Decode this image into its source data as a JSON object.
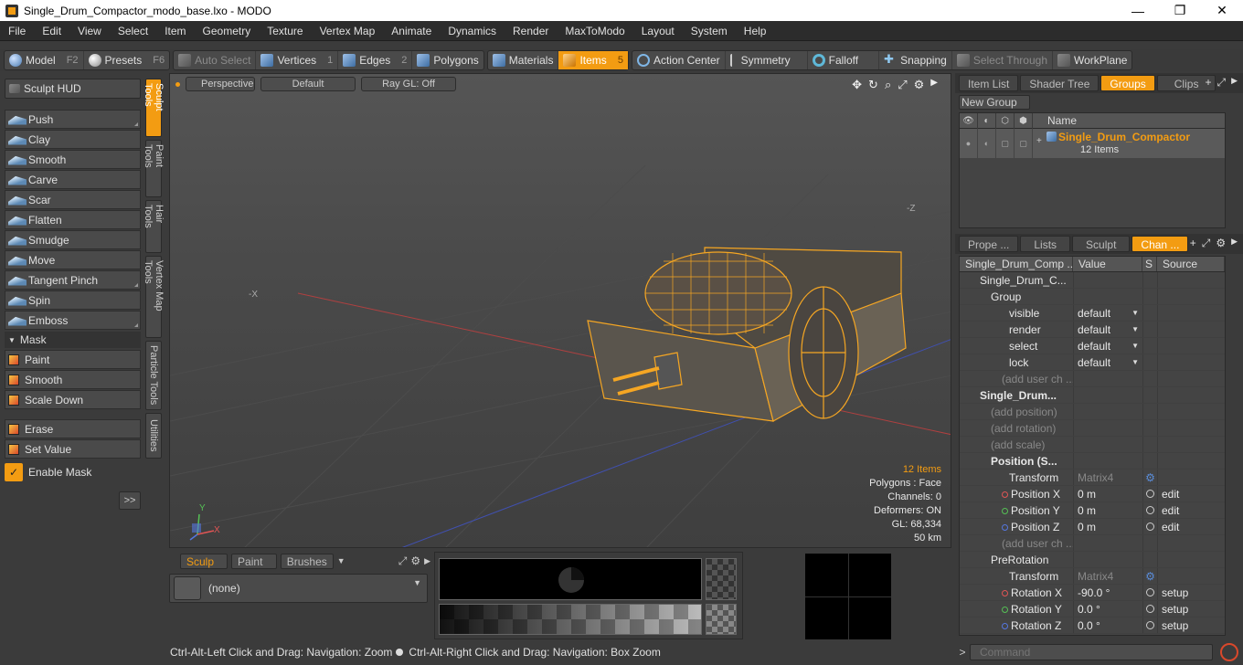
{
  "window": {
    "title": "Single_Drum_Compactor_modo_base.lxo - MODO",
    "minimize": "—",
    "maximize": "❐",
    "close": "✕"
  },
  "menu": [
    "File",
    "Edit",
    "View",
    "Select",
    "Item",
    "Geometry",
    "Texture",
    "Vertex Map",
    "Animate",
    "Dynamics",
    "Render",
    "MaxToModo",
    "Layout",
    "System",
    "Help"
  ],
  "toolbar": {
    "model": "Model",
    "model_key": "F2",
    "presets": "Presets",
    "presets_key": "F6",
    "auto_select": "Auto Select",
    "vertices": "Vertices",
    "vertices_key": "1",
    "edges": "Edges",
    "edges_key": "2",
    "polygons": "Polygons",
    "materials": "Materials",
    "items": "Items",
    "items_key": "5",
    "action_center": "Action Center",
    "symmetry": "Symmetry",
    "falloff": "Falloff",
    "snapping": "Snapping",
    "select_through": "Select Through",
    "workplane": "WorkPlane"
  },
  "left_panel": {
    "sculpt_hud": "Sculpt HUD",
    "tools": [
      "Push",
      "Clay",
      "Smooth",
      "Carve",
      "Scar",
      "Flatten",
      "Smudge",
      "Move",
      "Tangent Pinch",
      "Spin",
      "Emboss"
    ],
    "mask_header": "Mask",
    "mask_tools": [
      "Paint",
      "Smooth",
      "Scale Down"
    ],
    "extra_tools": [
      "Erase",
      "Set Value"
    ],
    "enable_mask": "Enable Mask",
    "more": ">>",
    "vertical_tabs": [
      "Sculpt Tools",
      "Paint Tools",
      "Hair Tools",
      "Vertex Map Tools",
      "Particle Tools",
      "Utilities"
    ]
  },
  "viewport": {
    "view": "Perspective",
    "style": "Default",
    "render": "Ray GL: Off",
    "axis_labels": {
      "neg_x": "-X",
      "neg_z": "-Z",
      "y": "Y",
      "x": "X"
    },
    "stats": {
      "items": "12 Items",
      "polygons": "Polygons : Face",
      "channels": "Channels: 0",
      "deformers": "Deformers: ON",
      "gl": "GL: 68,334",
      "scale": "50 km"
    }
  },
  "bottom_left": {
    "tabs": [
      "Sculp ...",
      "Paint ...",
      "Brushes"
    ],
    "field_value": "(none)"
  },
  "status": {
    "left": "Ctrl-Alt-Left Click and Drag: Navigation: Zoom",
    "right": "Ctrl-Alt-Right Click and Drag: Navigation: Box Zoom"
  },
  "groups_panel": {
    "tabs": [
      "Item List",
      "Shader Tree",
      "Groups",
      "Clips"
    ],
    "new_group": "New Group",
    "name_header": "Name",
    "group_name": "Single_Drum_Compactor",
    "group_count": "12 Items"
  },
  "channels_panel": {
    "tabs": [
      "Prope ...",
      "Lists",
      "Sculpt",
      "Chan ..."
    ],
    "headers": {
      "name": "Single_Drum_Comp ...",
      "value": "Value",
      "s": "S",
      "source": "Source"
    },
    "rows": [
      {
        "indent": 22,
        "label": "Single_Drum_C...",
        "value": "",
        "source": "",
        "type": "item"
      },
      {
        "indent": 34,
        "label": "Group",
        "value": "",
        "source": "",
        "type": "item"
      },
      {
        "indent": 54,
        "label": "visible",
        "value": "default",
        "source": "",
        "type": "dd"
      },
      {
        "indent": 54,
        "label": "render",
        "value": "default",
        "source": "",
        "type": "dd"
      },
      {
        "indent": 54,
        "label": "select",
        "value": "default",
        "source": "",
        "type": "dd"
      },
      {
        "indent": 54,
        "label": "lock",
        "value": "default",
        "source": "",
        "type": "dd"
      },
      {
        "indent": 46,
        "label": "(add user ch ...",
        "value": "",
        "source": "",
        "type": "dim"
      },
      {
        "indent": 22,
        "label": "Single_Drum...",
        "value": "",
        "source": "",
        "type": "bold"
      },
      {
        "indent": 34,
        "label": "(add position)",
        "value": "",
        "source": "",
        "type": "dim"
      },
      {
        "indent": 34,
        "label": "(add rotation)",
        "value": "",
        "source": "",
        "type": "dim"
      },
      {
        "indent": 34,
        "label": "(add scale)",
        "value": "",
        "source": "",
        "type": "dim"
      },
      {
        "indent": 34,
        "label": "Position (S...",
        "value": "",
        "source": "",
        "type": "bold"
      },
      {
        "indent": 54,
        "label": "Transform",
        "value": "Matrix4",
        "source": "",
        "type": "matrix"
      },
      {
        "indent": 46,
        "label": "Position X",
        "value": "0 m",
        "source": "edit",
        "type": "chan",
        "color": "#e05555"
      },
      {
        "indent": 46,
        "label": "Position Y",
        "value": "0 m",
        "source": "edit",
        "type": "chan",
        "color": "#55c055"
      },
      {
        "indent": 46,
        "label": "Position Z",
        "value": "0 m",
        "source": "edit",
        "type": "chan",
        "color": "#5577e0"
      },
      {
        "indent": 46,
        "label": "(add user ch ...",
        "value": "",
        "source": "",
        "type": "dim"
      },
      {
        "indent": 34,
        "label": "PreRotation",
        "value": "",
        "source": "",
        "type": "item"
      },
      {
        "indent": 54,
        "label": "Transform",
        "value": "Matrix4",
        "source": "",
        "type": "matrix"
      },
      {
        "indent": 46,
        "label": "Rotation X",
        "value": "-90.0 °",
        "source": "setup",
        "type": "chan",
        "color": "#e05555"
      },
      {
        "indent": 46,
        "label": "Rotation Y",
        "value": "0.0 °",
        "source": "setup",
        "type": "chan",
        "color": "#55c055"
      },
      {
        "indent": 46,
        "label": "Rotation Z",
        "value": "0.0 °",
        "source": "setup",
        "type": "chan",
        "color": "#5577e0"
      }
    ]
  },
  "command": {
    "placeholder": "Command",
    "prompt": ">"
  },
  "colors": {
    "accent": "#f39c12",
    "panel": "#3b3b3b",
    "wire": "#f5a623"
  }
}
